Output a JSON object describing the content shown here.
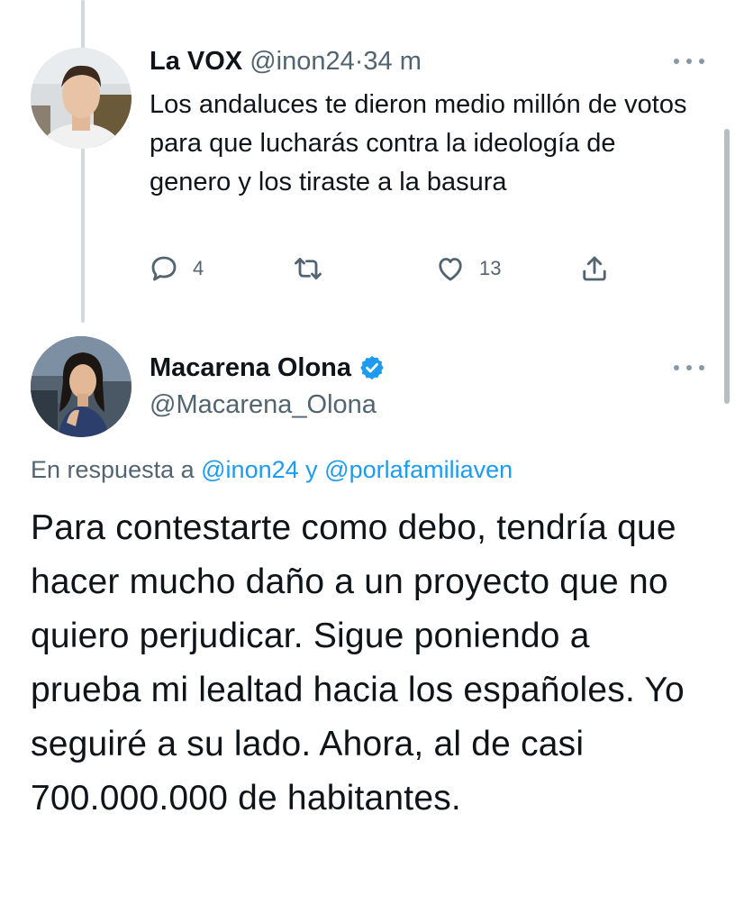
{
  "tweet1": {
    "display_name": "La VOX",
    "handle": "@inon24",
    "separator": "·",
    "time": "34 m",
    "text": "Los andaluces te dieron medio millón de votos para que lucharás contra la ideología de genero y los tiraste a la basura",
    "reply_count": "4",
    "like_count": "13",
    "icons": [
      "reply-icon",
      "retweet-icon",
      "like-icon",
      "share-icon",
      "more-icon"
    ]
  },
  "tweet2": {
    "display_name": "Macarena Olona",
    "handle": "@Macarena_Olona",
    "reply_prefix": "En respuesta a",
    "reply_mention_1": "@inon24",
    "reply_conjunction": "y",
    "reply_mention_2": "@porlafamiliaven",
    "text": "Para contestarte como debo, tendría que hacer mucho daño a un proyecto que no quiero perjudicar. Sigue poniendo a prueba mi lealtad hacia los españoles. Yo seguiré a su lado. Ahora, al de casi 700.000.000 de habitantes.",
    "icons": [
      "verified-icon",
      "more-icon"
    ]
  },
  "colors": {
    "text": "#0f1419",
    "muted": "#536471",
    "accent": "#1d9bf0",
    "thread_line": "#cfd9de"
  }
}
